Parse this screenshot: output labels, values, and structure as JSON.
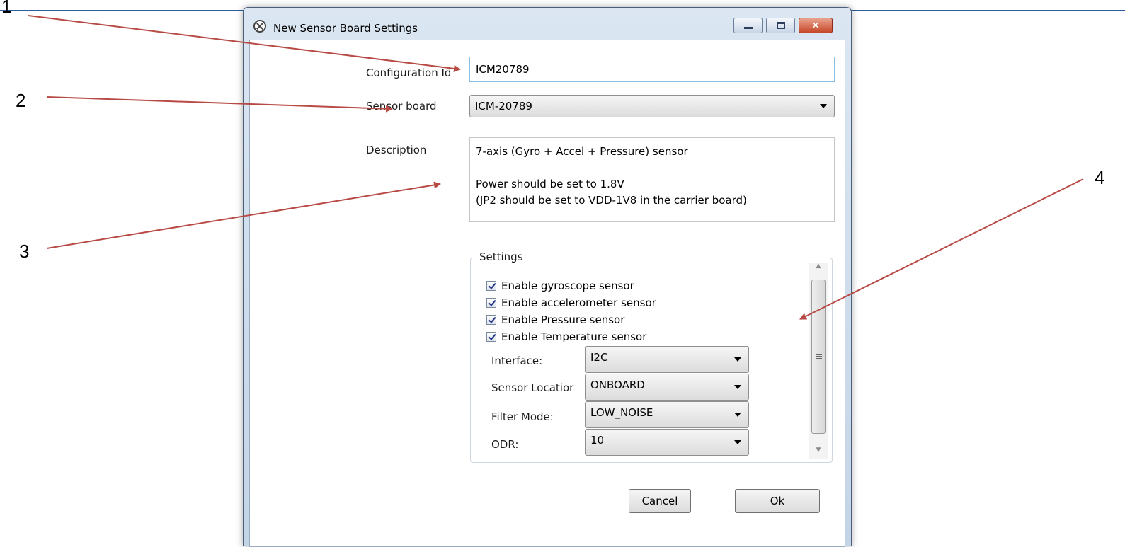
{
  "annotations": {
    "c1": "1",
    "c2": "2",
    "c3": "3",
    "c4": "4",
    "arrow_color": "#b84a45"
  },
  "dialog": {
    "title": "New Sensor Board Settings",
    "window_buttons": {
      "minimize": "—",
      "maximize": "□",
      "close": "✕"
    }
  },
  "form": {
    "configuration_id_label": "Configuration Id",
    "configuration_id_value": "ICM20789",
    "sensor_board_label": "Sensor board",
    "sensor_board_value": "ICM-20789",
    "description_label": "Description",
    "description_lines": [
      "7-axis (Gyro + Accel + Pressure) sensor",
      "Power should be set to 1.8V",
      "(JP2 should be set to VDD-1V8 in the carrier board)"
    ]
  },
  "settings": {
    "title": "Settings",
    "checkboxes": [
      {
        "label": "Enable gyroscope sensor",
        "checked": true
      },
      {
        "label": "Enable accelerometer sensor",
        "checked": true
      },
      {
        "label": "Enable Pressure sensor",
        "checked": true
      },
      {
        "label": "Enable Temperature sensor",
        "checked": true
      }
    ],
    "fields": [
      {
        "label": "Interface:",
        "value": "I2C"
      },
      {
        "label": "Sensor Locatior",
        "value": "ONBOARD"
      },
      {
        "label": "Filter Mode:",
        "value": "LOW_NOISE"
      },
      {
        "label": "ODR:",
        "value": "10"
      }
    ],
    "scrollbar": {
      "up": "▲",
      "down": "▼"
    }
  },
  "buttons": {
    "cancel": "Cancel",
    "ok": "Ok"
  },
  "colors": {
    "titlebar": "#c9d8ea",
    "accent_border": "#8ec0e6",
    "close_button": "#c7482a"
  }
}
